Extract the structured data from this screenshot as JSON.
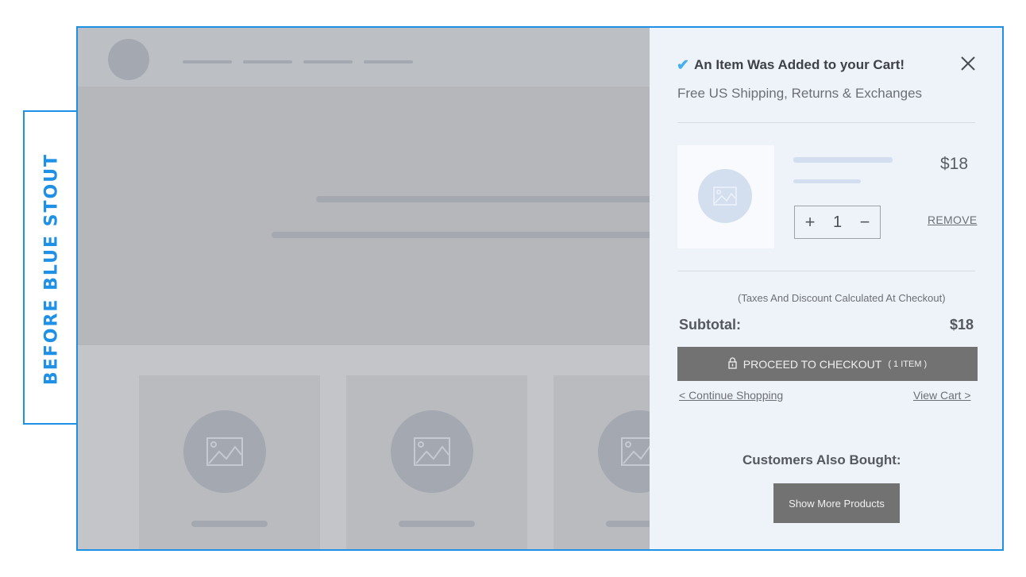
{
  "side_label": "BEFORE  BLUE STOUT",
  "cart": {
    "title": "An Item Was Added to your Cart!",
    "subtitle": "Free US Shipping, Returns & Exchanges",
    "item": {
      "price": "$18",
      "quantity": "1",
      "remove_label": "REMOVE"
    },
    "taxes_note": "(Taxes And Discount Calculated At Checkout)",
    "subtotal_label": "Subtotal:",
    "subtotal_value": "$18",
    "checkout_label": "PROCEED TO CHECKOUT",
    "checkout_count": "( 1 ITEM )",
    "continue_label": "< Continue Shopping",
    "view_cart_label": "View Cart >",
    "also_bought_title": "Customers Also Bought:",
    "show_more_label": "Show More Products"
  },
  "icons": [
    "check-icon",
    "close-icon",
    "image-placeholder-icon",
    "lock-icon",
    "plus-icon",
    "minus-icon"
  ],
  "colors": {
    "accent": "#1e90e6",
    "check": "#45aef0",
    "button": "#727272",
    "drawer_bg": "#eef3fa",
    "overlay": "#c2c4c7"
  }
}
